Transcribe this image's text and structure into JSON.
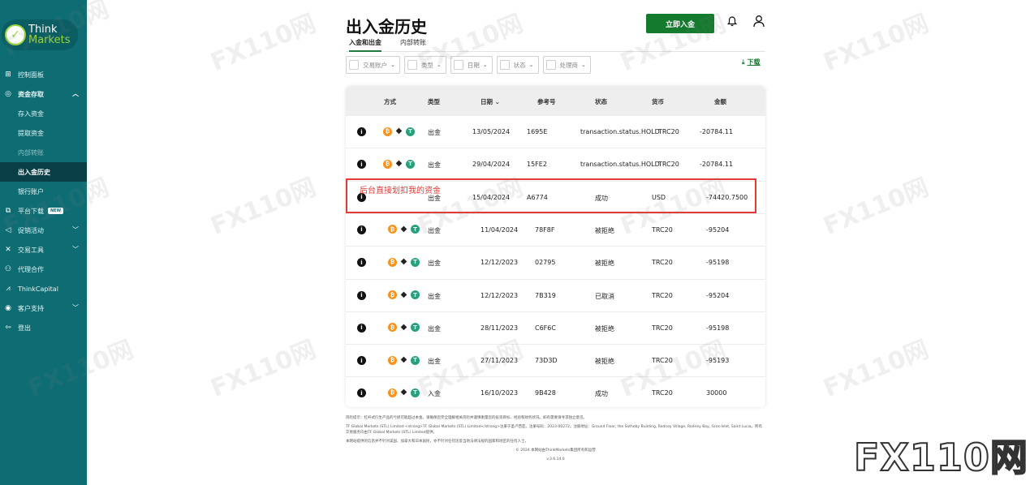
{
  "sidebar": {
    "logo": {
      "line1": "Think",
      "line2": "Markets"
    },
    "items": [
      {
        "label": "控制面板"
      },
      {
        "label": "资金存取"
      },
      {
        "label": "存入资金"
      },
      {
        "label": "提取资金"
      },
      {
        "label": "内部转账"
      },
      {
        "label": "出入金历史"
      },
      {
        "label": "银行账户"
      },
      {
        "label": "平台下载",
        "badge": "NEW"
      },
      {
        "label": "促销活动"
      },
      {
        "label": "交易工具"
      },
      {
        "label": "代理合作"
      },
      {
        "label": "ThinkCapital"
      },
      {
        "label": "客户支持"
      },
      {
        "label": "登出"
      }
    ]
  },
  "header": {
    "title": "出入金历史",
    "tabs": [
      {
        "label": "入金和出金"
      },
      {
        "label": "内部转账"
      }
    ],
    "deposit_button": "立即入金"
  },
  "filters": [
    {
      "label": "交易账户"
    },
    {
      "label": "类型"
    },
    {
      "label": "日期"
    },
    {
      "label": "状态"
    },
    {
      "label": "处理商"
    }
  ],
  "download_label": "下载",
  "table": {
    "headers": [
      "方式",
      "类型",
      "日期",
      "参考号",
      "状态",
      "货币",
      "金额"
    ],
    "rows": [
      {
        "type": "出金",
        "date": "13/05/2024",
        "ref": "1695E",
        "status": "transaction.status.HOLD",
        "currency": "TRC20",
        "amount": "-20784.11",
        "coins": true
      },
      {
        "type": "出金",
        "date": "29/04/2024",
        "ref": "15FE2",
        "status": "transaction.status.HOLD",
        "currency": "TRC20",
        "amount": "-20784.11",
        "coins": true
      },
      {
        "type": "出金",
        "date": "15/04/2024",
        "ref": "A6774",
        "status": "成功",
        "currency": "USD",
        "amount": "-74420.7500",
        "coins": false
      },
      {
        "type": "出金",
        "date": "11/04/2024",
        "ref": "78F8F",
        "status": "被拒绝",
        "currency": "TRC20",
        "amount": "-95204",
        "coins": true
      },
      {
        "type": "出金",
        "date": "12/12/2023",
        "ref": "02795",
        "status": "被拒绝",
        "currency": "TRC20",
        "amount": "-95198",
        "coins": true
      },
      {
        "type": "出金",
        "date": "12/12/2023",
        "ref": "7B319",
        "status": "已取消",
        "currency": "TRC20",
        "amount": "-95204",
        "coins": true
      },
      {
        "type": "出金",
        "date": "28/11/2023",
        "ref": "C6F6C",
        "status": "被拒绝",
        "currency": "TRC20",
        "amount": "-95198",
        "coins": true
      },
      {
        "type": "出金",
        "date": "27/11/2023",
        "ref": "73D3D",
        "status": "被拒绝",
        "currency": "TRC20",
        "amount": "-95193",
        "coins": true
      },
      {
        "type": "入金",
        "date": "16/10/2023",
        "ref": "9B428",
        "status": "成功",
        "currency": "TRC20",
        "amount": "30000",
        "coins": true
      }
    ]
  },
  "annotation": "后台直接划扣我的资金",
  "footer": {
    "risk": "风险提示：杠杆式衍生产品的亏损可能超过本金。请确保您完全理解相关风险并谨慎衡量您的投资目标、经验和财务状况。如有需要请寻求独立意见。",
    "company": "TF Global Markets (STL) Limited <strong>TF Global Markets (STL) Limited</strong>注册于圣卢西亚。注册号码：2023-00272。注册地址：Ground Floor, the Sotheby Building, Rodney Village, Rodney Bay, Gros-Islet, Saint Lucia。所有交易服务均由TF Global Markets (STL) Limited提供。",
    "notice": "本网站提供的信息并不针对美国、加拿大和日本居民，亦不针对任何违反当地法律法规的国家和地区的任何人士。",
    "copyright": "© 2024 本网站由ThinkMarkets集团所有和运营",
    "version": "v.3.6.14.0"
  },
  "watermark": {
    "text": "FX110网",
    "big": "FX110网"
  },
  "colors": {
    "sidebar": "#0d6d73",
    "sidebar_active": "#0a3f45",
    "accent": "#137a2e",
    "highlight": "#e53935",
    "btc": "#f7931a",
    "usdt": "#26a17b"
  },
  "icons": {
    "bell": "bell-icon",
    "user": "user-icon",
    "info": "info-icon",
    "download": "download-icon"
  }
}
